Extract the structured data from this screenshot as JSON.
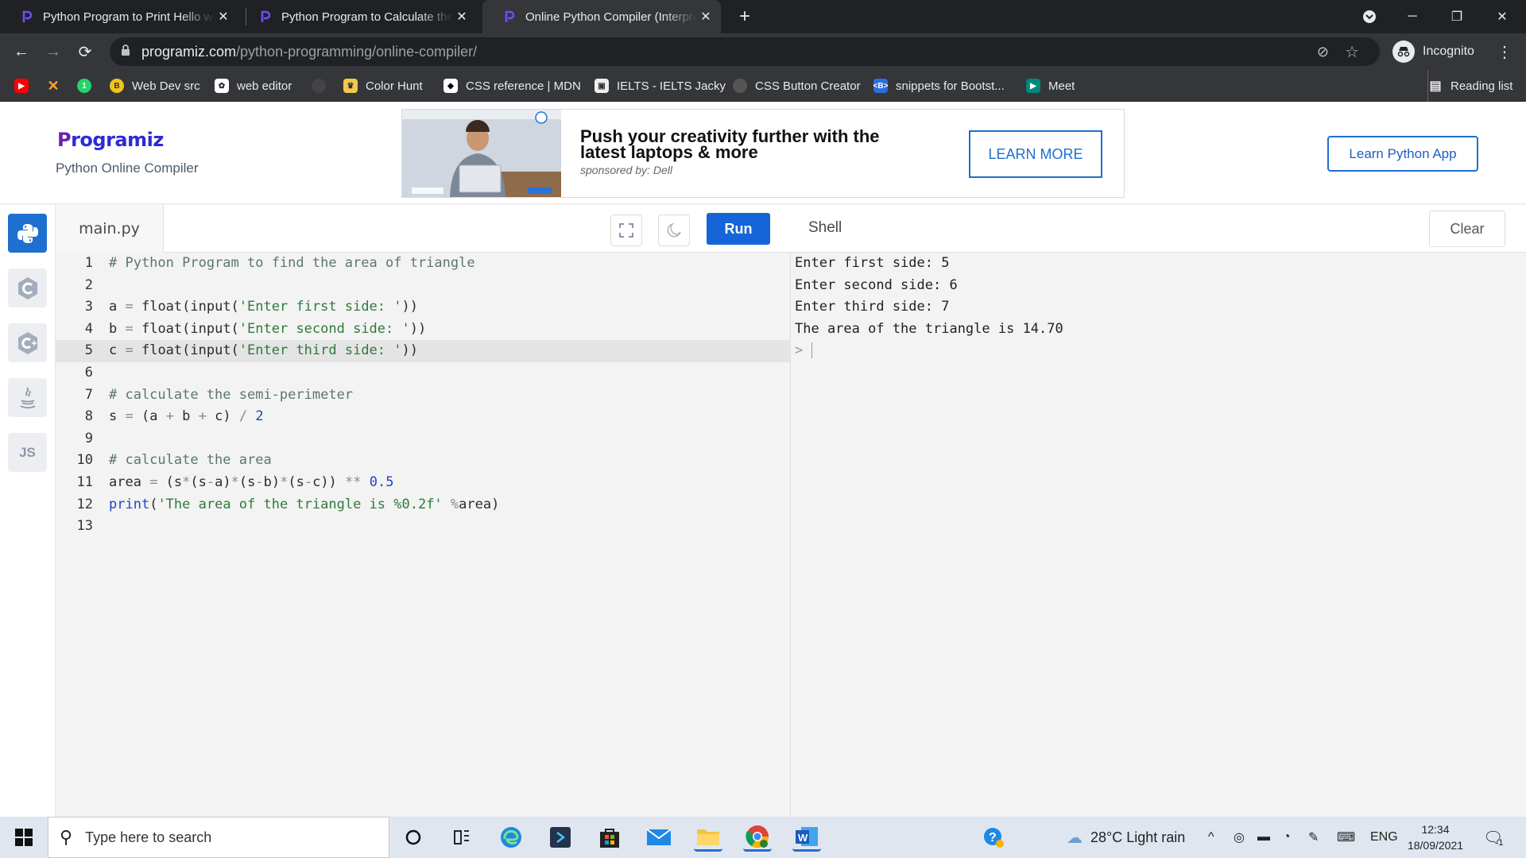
{
  "browser": {
    "tabs": [
      {
        "title": "Python Program to Print Hello w"
      },
      {
        "title": "Python Program to Calculate the"
      },
      {
        "title": "Online Python Compiler (Interpre"
      }
    ],
    "url_host": "programiz.com",
    "url_path": "/python-programming/online-compiler/",
    "profile_label": "Incognito",
    "bookmarks": [
      {
        "label": "Web Dev src"
      },
      {
        "label": "web editor"
      },
      {
        "label": "Color Hunt"
      },
      {
        "label": "CSS reference | MDN"
      },
      {
        "label": "IELTS - IELTS Jacky"
      },
      {
        "label": "CSS Button Creator"
      },
      {
        "label": "snippets for Bootst..."
      },
      {
        "label": "Meet"
      }
    ],
    "reading_list": "Reading list"
  },
  "header": {
    "logo": "rogramiz",
    "logo_prefix": "P",
    "subtitle": "Python Online Compiler",
    "learn_app": "Learn Python App"
  },
  "ad": {
    "headline": "Push your creativity further with the latest laptops & more",
    "sponsor": "sponsored by: Dell",
    "cta": "LEARN MORE"
  },
  "sidebar": {
    "js_label": "JS"
  },
  "editor": {
    "filename": "main.py",
    "run_label": "Run"
  },
  "shell": {
    "title": "Shell",
    "clear_label": "Clear",
    "output": [
      "Enter first side: 5",
      "Enter second side: 6",
      "Enter third side: 7",
      "The area of the triangle is 14.70",
      ">"
    ]
  },
  "taskbar": {
    "search_placeholder": "Type here to search",
    "weather": "28°C  Light rain",
    "language": "ENG",
    "time": "12:34",
    "date": "18/09/2021",
    "notification_count": "1"
  }
}
